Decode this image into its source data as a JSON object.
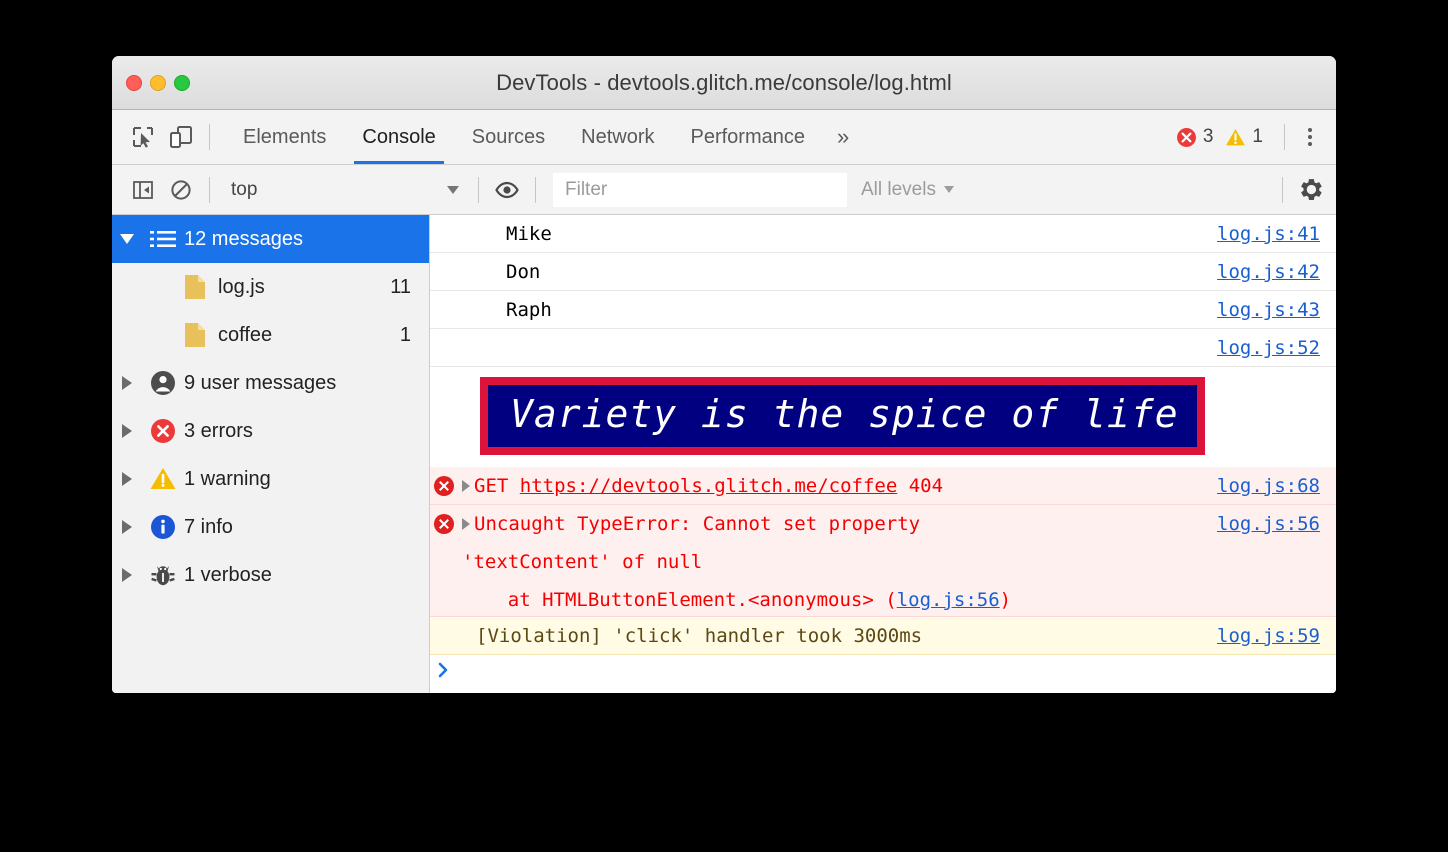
{
  "window": {
    "title": "DevTools - devtools.glitch.me/console/log.html",
    "traffic_lights": [
      "close",
      "minimize",
      "maximize"
    ]
  },
  "tabbar": {
    "inspect_icon": "inspect-element-icon",
    "device_icon": "device-toolbar-icon",
    "tabs": [
      {
        "label": "Elements",
        "active": false
      },
      {
        "label": "Console",
        "active": true
      },
      {
        "label": "Sources",
        "active": false
      },
      {
        "label": "Network",
        "active": false
      },
      {
        "label": "Performance",
        "active": false
      }
    ],
    "more_tabs": "»",
    "error_count": "3",
    "warning_count": "1",
    "menu_icon": "kebab-menu-icon"
  },
  "console_toolbar": {
    "sidebar_toggle_icon": "sidebar-toggle-icon",
    "clear_icon": "clear-console-icon",
    "context": "top",
    "eye_icon": "live-expression-eye-icon",
    "filter_placeholder": "Filter",
    "filter_value": "",
    "levels": "All levels",
    "settings_icon": "settings-gear-icon"
  },
  "sidebar": {
    "items": [
      {
        "label": "12 messages",
        "count": "",
        "icon": "list-icon",
        "selected": true,
        "expanded": true,
        "child": false
      },
      {
        "label": "log.js",
        "count": "11",
        "icon": "file-icon",
        "selected": false,
        "expanded": false,
        "child": true
      },
      {
        "label": "coffee",
        "count": "1",
        "icon": "file-icon",
        "selected": false,
        "expanded": false,
        "child": true
      },
      {
        "label": "9 user messages",
        "count": "",
        "icon": "user-icon",
        "selected": false,
        "expanded": false,
        "child": false
      },
      {
        "label": "3 errors",
        "count": "",
        "icon": "error-icon",
        "selected": false,
        "expanded": false,
        "child": false
      },
      {
        "label": "1 warning",
        "count": "",
        "icon": "warning-icon",
        "selected": false,
        "expanded": false,
        "child": false
      },
      {
        "label": "7 info",
        "count": "",
        "icon": "info-icon",
        "selected": false,
        "expanded": false,
        "child": false
      },
      {
        "label": "1 verbose",
        "count": "",
        "icon": "bug-icon",
        "selected": false,
        "expanded": false,
        "child": false
      }
    ]
  },
  "console": {
    "messages": [
      {
        "kind": "grouped",
        "text": "Mike",
        "source": "log.js:41"
      },
      {
        "kind": "grouped",
        "text": "Don",
        "source": "log.js:42"
      },
      {
        "kind": "grouped",
        "text": "Raph",
        "source": "log.js:43"
      },
      {
        "kind": "styled-source",
        "text": "",
        "source": "log.js:52"
      },
      {
        "kind": "styled",
        "text": "Variety is the spice of life",
        "source": ""
      },
      {
        "kind": "error-get",
        "prefix": "GET",
        "url": "https://devtools.glitch.me/coffee",
        "status": "404",
        "source": "log.js:68"
      },
      {
        "kind": "error-stack",
        "line1": "Uncaught TypeError: Cannot set property",
        "line2": "'textContent' of null",
        "line3_pre": "at HTMLButtonElement.<anonymous> (",
        "line3_link": "log.js:56",
        "line3_post": ")",
        "source": "log.js:56"
      },
      {
        "kind": "violation",
        "text": "[Violation] 'click' handler took 3000ms",
        "source": "log.js:59"
      }
    ],
    "prompt_symbol": "›",
    "prompt_value": ""
  },
  "colors": {
    "accent": "#1a73e8",
    "error_red": "#df2020",
    "error_text": "#f40000",
    "warning_yellow": "#f5c400",
    "styled_bg": "#000080",
    "styled_border": "#dc143c",
    "violation_bg": "#fffbe5",
    "error_bg": "#fff0f0"
  }
}
